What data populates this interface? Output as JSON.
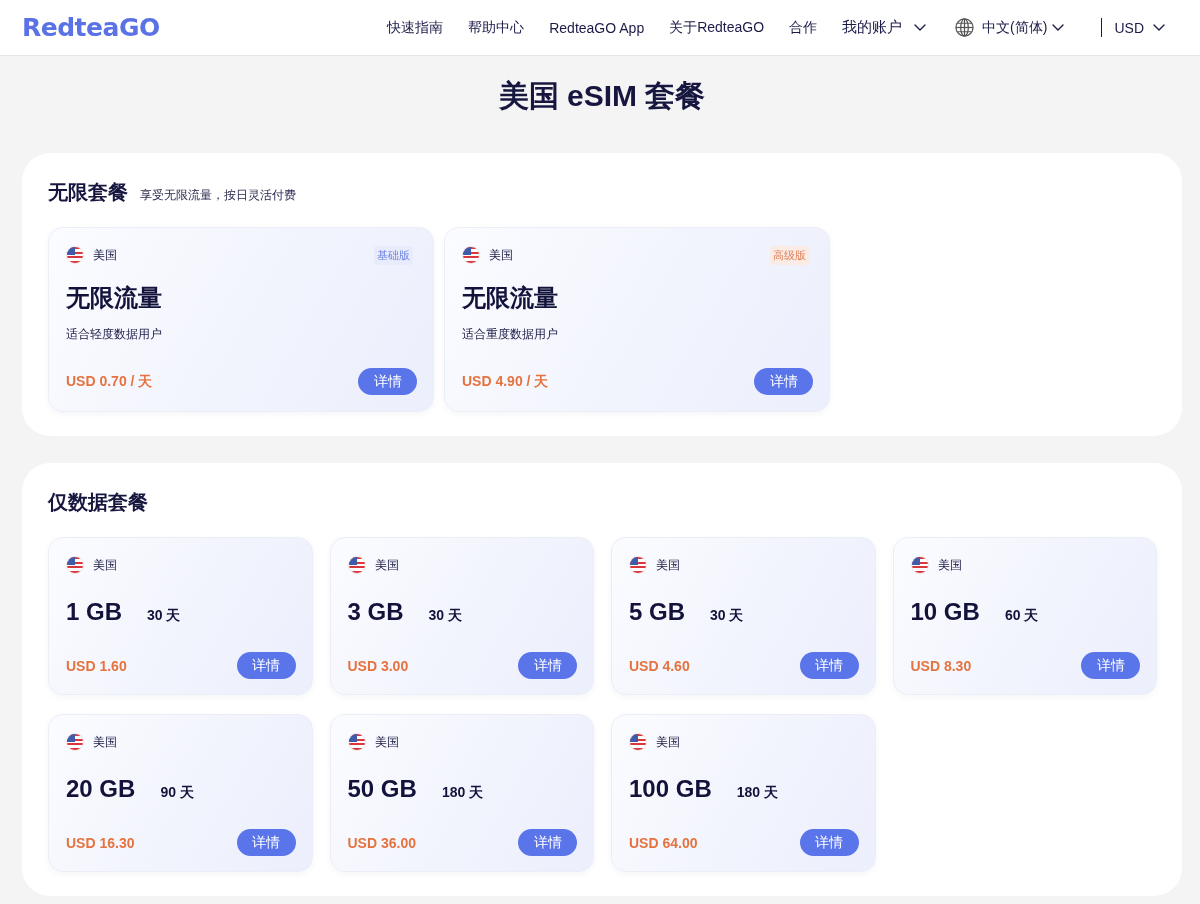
{
  "header": {
    "logo": "RedteaGO",
    "nav": [
      {
        "label": "快速指南",
        "kind": "link"
      },
      {
        "label": "帮助中心",
        "kind": "link"
      },
      {
        "label": "RedteaGO App",
        "kind": "link"
      },
      {
        "label": "关于RedteaGO",
        "kind": "link"
      },
      {
        "label": "合作",
        "kind": "link"
      },
      {
        "label": "我的账户",
        "kind": "dropdown"
      },
      {
        "label": "中文(简体)",
        "kind": "language"
      },
      {
        "label": "USD",
        "kind": "currency"
      }
    ]
  },
  "title": "美国 eSIM 套餐",
  "sections": [
    {
      "kind": "unlimited",
      "heading": "无限套餐",
      "subtitle": "享受无限流量，按日灵活付费",
      "plans": [
        {
          "country": "美国",
          "badge": {
            "label": "基础版",
            "color": "#6f84e4"
          },
          "title": "无限流量",
          "description": "适合轻度数据用户",
          "price": "USD 0.70 / 天",
          "button": "详情"
        },
        {
          "country": "美国",
          "badge": {
            "label": "高级版",
            "color": "#e0815a"
          },
          "title": "无限流量",
          "description": "适合重度数据用户",
          "price": "USD 4.90 / 天",
          "button": "详情"
        }
      ]
    },
    {
      "kind": "data",
      "heading": "仅数据套餐",
      "plans": [
        {
          "country": "美国",
          "data": "1 GB",
          "duration": "30 天",
          "price": "USD 1.60",
          "button": "详情"
        },
        {
          "country": "美国",
          "data": "3 GB",
          "duration": "30 天",
          "price": "USD 3.00",
          "button": "详情"
        },
        {
          "country": "美国",
          "data": "5 GB",
          "duration": "30 天",
          "price": "USD 4.60",
          "button": "详情"
        },
        {
          "country": "美国",
          "data": "10 GB",
          "duration": "60 天",
          "price": "USD 8.30",
          "button": "详情"
        },
        {
          "country": "美国",
          "data": "20 GB",
          "duration": "90 天",
          "price": "USD 16.30",
          "button": "详情"
        },
        {
          "country": "美国",
          "data": "50 GB",
          "duration": "180 天",
          "price": "USD 36.00",
          "button": "详情"
        },
        {
          "country": "美国",
          "data": "100 GB",
          "duration": "180 天",
          "price": "USD 64.00",
          "button": "详情"
        }
      ]
    }
  ]
}
